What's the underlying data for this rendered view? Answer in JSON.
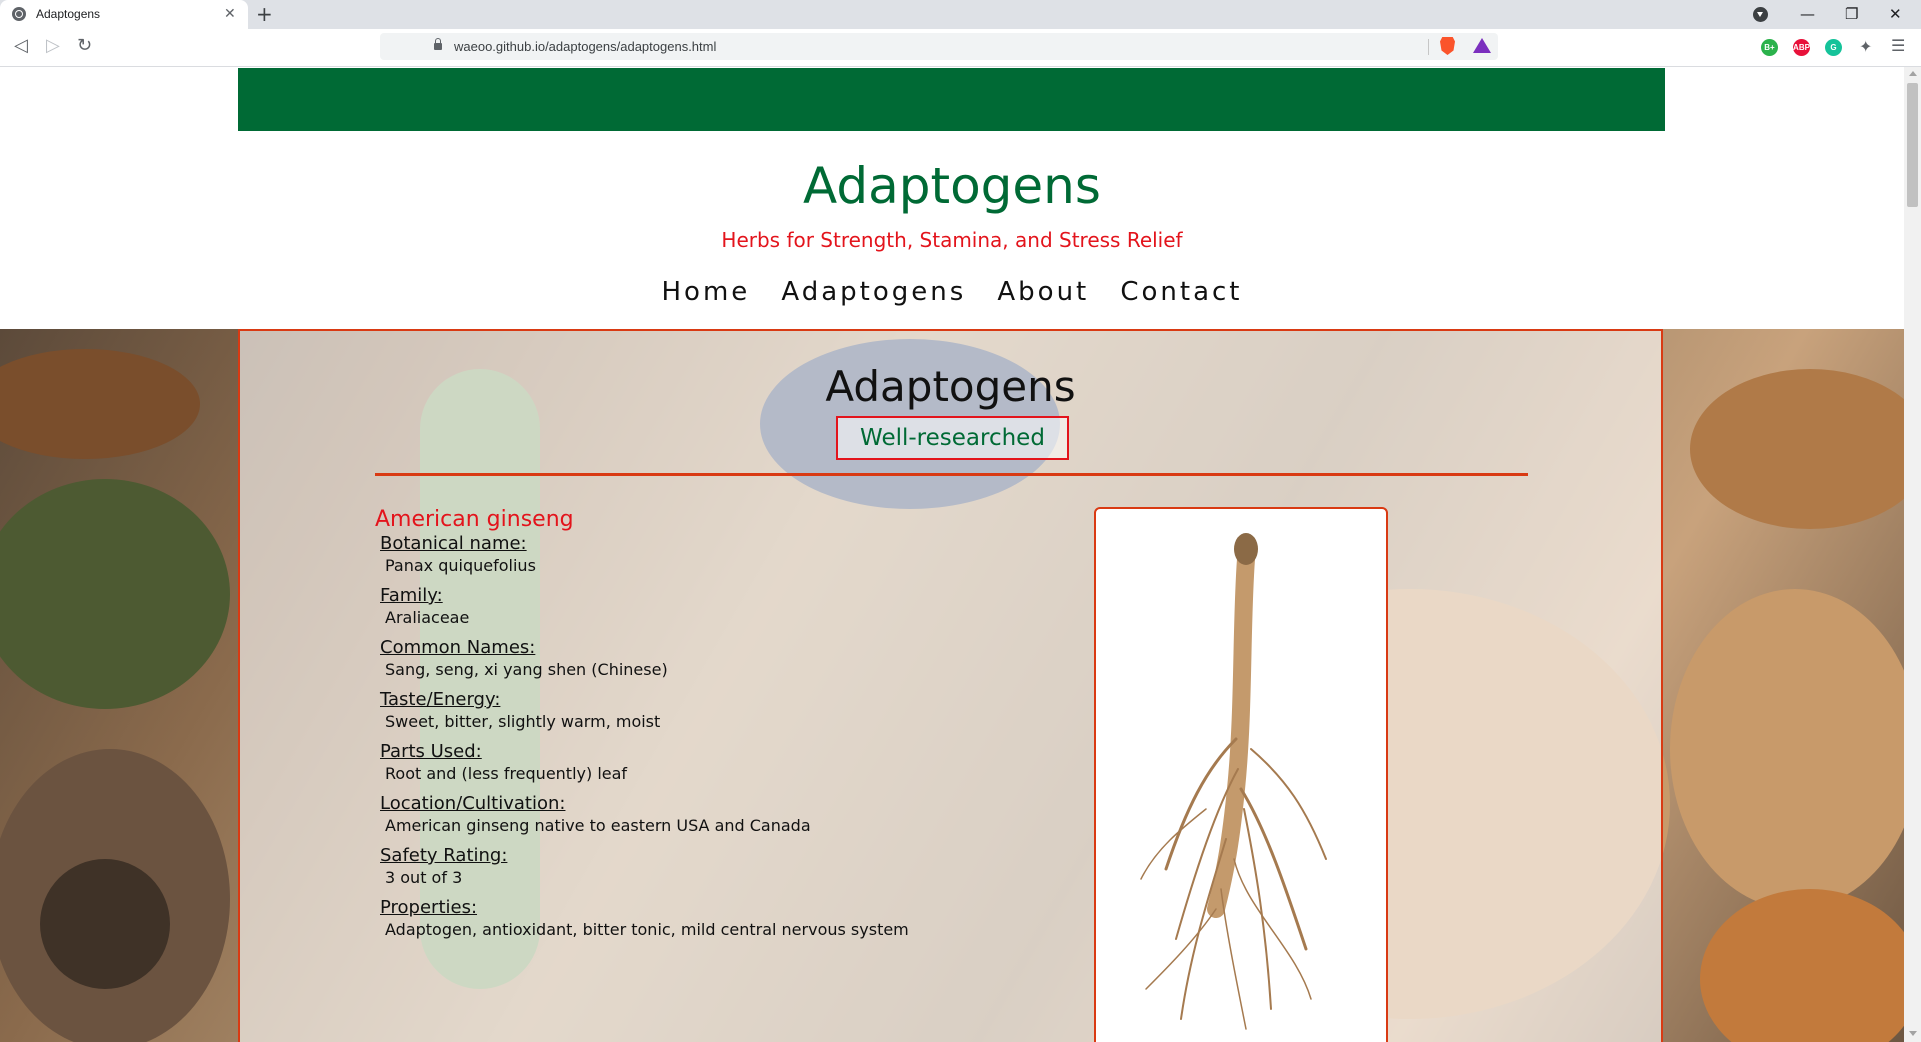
{
  "browser": {
    "tab_title": "Adaptogens",
    "url": "waeoo.github.io/adaptogens/adaptogens.html",
    "extensions": [
      {
        "label": "B+",
        "color": "#2bb24c"
      },
      {
        "label": "ABP",
        "color": "#e8113a"
      },
      {
        "label": "G",
        "color": "#15c39a"
      }
    ]
  },
  "site": {
    "title": "Adaptogens",
    "subtitle": "Herbs for Strength, Stamina, and Stress Relief",
    "nav": [
      "Home",
      "Adaptogens",
      "About",
      "Contact"
    ]
  },
  "content": {
    "heading": "Adaptogens",
    "badge": "Well-researched",
    "herb": {
      "name": "American ginseng",
      "fields": [
        {
          "label": "Botanical name:",
          "value": "Panax quiquefolius"
        },
        {
          "label": "Family:",
          "value": "Araliaceae"
        },
        {
          "label": "Common Names:",
          "value": "Sang, seng, xi yang shen (Chinese)"
        },
        {
          "label": "Taste/Energy:",
          "value": "Sweet, bitter, slightly warm, moist"
        },
        {
          "label": "Parts Used:",
          "value": "Root and (less frequently) leaf"
        },
        {
          "label": "Location/Cultivation:",
          "value": "American ginseng native to eastern USA and Canada"
        },
        {
          "label": "Safety Rating:",
          "value": "3 out of 3"
        },
        {
          "label": "Properties:",
          "value": "Adaptogen, antioxidant, bitter tonic, mild central nervous system"
        }
      ]
    }
  },
  "colors": {
    "brand_green": "#006a35",
    "accent_red": "#e3141c",
    "border_orange": "#d93a13"
  }
}
